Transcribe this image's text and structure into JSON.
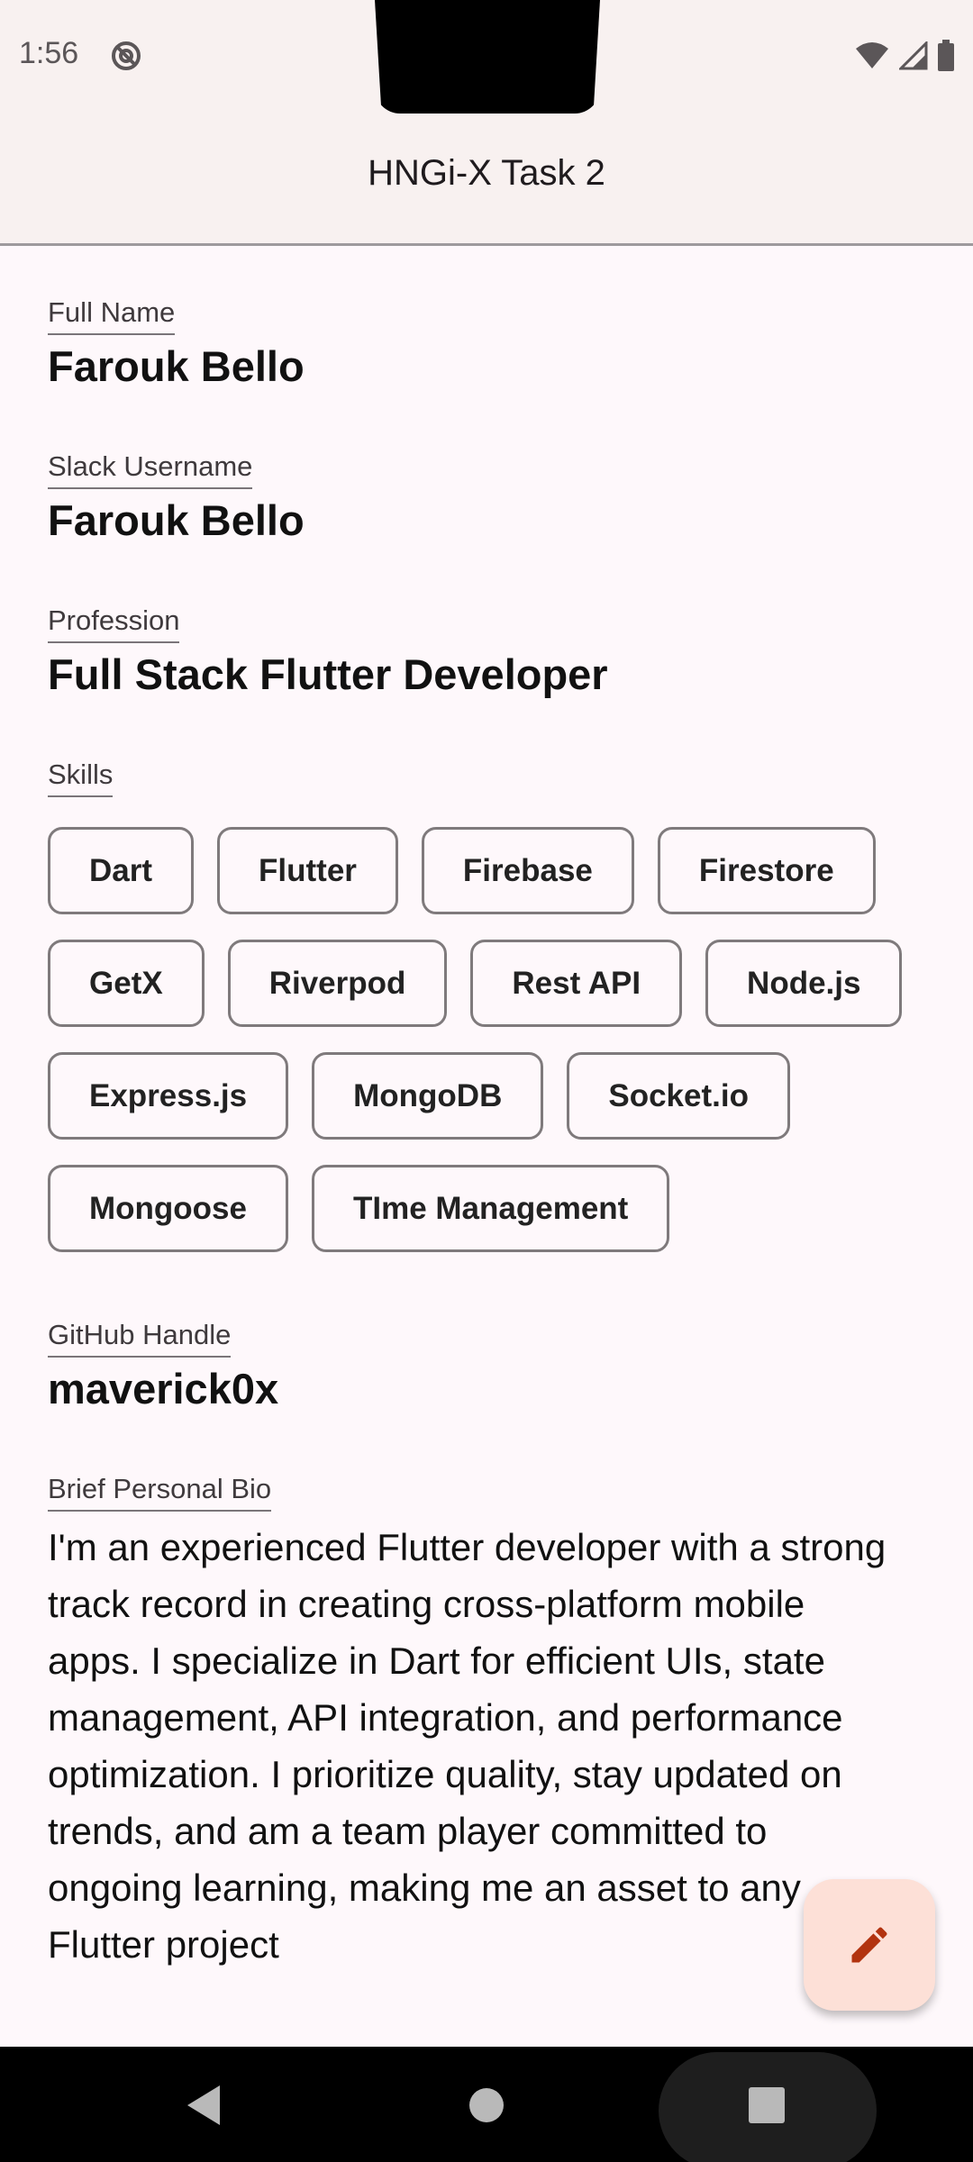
{
  "status_bar": {
    "time": "1:56",
    "icons": [
      "dnd-icon",
      "wifi-icon",
      "signal-icon",
      "battery-icon"
    ]
  },
  "app_bar": {
    "title": "HNGi-X Task 2"
  },
  "profile": {
    "full_name": {
      "label": "Full Name",
      "value": "Farouk Bello"
    },
    "slack_username": {
      "label": "Slack Username",
      "value": "Farouk Bello"
    },
    "profession": {
      "label": "Profession",
      "value": "Full Stack Flutter Developer"
    },
    "skills": {
      "label": "Skills",
      "rows": [
        [
          "Dart",
          "Flutter",
          "Firebase",
          "Firestore"
        ],
        [
          "GetX",
          "Riverpod",
          "Rest API",
          "Node.js"
        ],
        [
          "Express.js",
          "MongoDB",
          "Socket.io"
        ],
        [
          "Mongoose",
          "TIme Management"
        ]
      ]
    },
    "github_handle": {
      "label": "GitHub Handle",
      "value": "maverick0x"
    },
    "bio": {
      "label": "Brief Personal Bio",
      "value": "I'm an experienced Flutter developer with a strong track record in creating cross-platform mobile apps. I specialize in Dart for efficient UIs, state management, API integration, and performance optimization. I prioritize quality, stay updated on trends, and am a team player committed to ongoing learning, making me an asset to any Flutter project"
    }
  },
  "fab": {
    "icon": "edit-pencil-icon"
  },
  "nav_bar": {
    "icons": [
      "back-icon",
      "home-icon",
      "recents-icon"
    ]
  },
  "colors": {
    "app_bar_bg": "#f8f1f0",
    "page_bg": "#fef8fb",
    "chip_border": "#7f7a7c",
    "fab_bg": "#fde0d7",
    "fab_icon": "#b2330f"
  }
}
